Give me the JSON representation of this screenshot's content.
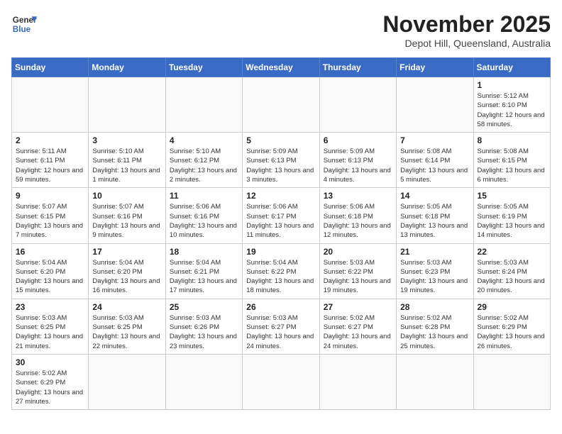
{
  "header": {
    "logo_general": "General",
    "logo_blue": "Blue",
    "month_title": "November 2025",
    "subtitle": "Depot Hill, Queensland, Australia"
  },
  "weekdays": [
    "Sunday",
    "Monday",
    "Tuesday",
    "Wednesday",
    "Thursday",
    "Friday",
    "Saturday"
  ],
  "weeks": [
    [
      {
        "day": "",
        "info": ""
      },
      {
        "day": "",
        "info": ""
      },
      {
        "day": "",
        "info": ""
      },
      {
        "day": "",
        "info": ""
      },
      {
        "day": "",
        "info": ""
      },
      {
        "day": "",
        "info": ""
      },
      {
        "day": "1",
        "info": "Sunrise: 5:12 AM\nSunset: 6:10 PM\nDaylight: 12 hours and 58 minutes."
      }
    ],
    [
      {
        "day": "2",
        "info": "Sunrise: 5:11 AM\nSunset: 6:11 PM\nDaylight: 12 hours and 59 minutes."
      },
      {
        "day": "3",
        "info": "Sunrise: 5:10 AM\nSunset: 6:11 PM\nDaylight: 13 hours and 1 minute."
      },
      {
        "day": "4",
        "info": "Sunrise: 5:10 AM\nSunset: 6:12 PM\nDaylight: 13 hours and 2 minutes."
      },
      {
        "day": "5",
        "info": "Sunrise: 5:09 AM\nSunset: 6:13 PM\nDaylight: 13 hours and 3 minutes."
      },
      {
        "day": "6",
        "info": "Sunrise: 5:09 AM\nSunset: 6:13 PM\nDaylight: 13 hours and 4 minutes."
      },
      {
        "day": "7",
        "info": "Sunrise: 5:08 AM\nSunset: 6:14 PM\nDaylight: 13 hours and 5 minutes."
      },
      {
        "day": "8",
        "info": "Sunrise: 5:08 AM\nSunset: 6:15 PM\nDaylight: 13 hours and 6 minutes."
      }
    ],
    [
      {
        "day": "9",
        "info": "Sunrise: 5:07 AM\nSunset: 6:15 PM\nDaylight: 13 hours and 7 minutes."
      },
      {
        "day": "10",
        "info": "Sunrise: 5:07 AM\nSunset: 6:16 PM\nDaylight: 13 hours and 9 minutes."
      },
      {
        "day": "11",
        "info": "Sunrise: 5:06 AM\nSunset: 6:16 PM\nDaylight: 13 hours and 10 minutes."
      },
      {
        "day": "12",
        "info": "Sunrise: 5:06 AM\nSunset: 6:17 PM\nDaylight: 13 hours and 11 minutes."
      },
      {
        "day": "13",
        "info": "Sunrise: 5:06 AM\nSunset: 6:18 PM\nDaylight: 13 hours and 12 minutes."
      },
      {
        "day": "14",
        "info": "Sunrise: 5:05 AM\nSunset: 6:18 PM\nDaylight: 13 hours and 13 minutes."
      },
      {
        "day": "15",
        "info": "Sunrise: 5:05 AM\nSunset: 6:19 PM\nDaylight: 13 hours and 14 minutes."
      }
    ],
    [
      {
        "day": "16",
        "info": "Sunrise: 5:04 AM\nSunset: 6:20 PM\nDaylight: 13 hours and 15 minutes."
      },
      {
        "day": "17",
        "info": "Sunrise: 5:04 AM\nSunset: 6:20 PM\nDaylight: 13 hours and 16 minutes."
      },
      {
        "day": "18",
        "info": "Sunrise: 5:04 AM\nSunset: 6:21 PM\nDaylight: 13 hours and 17 minutes."
      },
      {
        "day": "19",
        "info": "Sunrise: 5:04 AM\nSunset: 6:22 PM\nDaylight: 13 hours and 18 minutes."
      },
      {
        "day": "20",
        "info": "Sunrise: 5:03 AM\nSunset: 6:22 PM\nDaylight: 13 hours and 19 minutes."
      },
      {
        "day": "21",
        "info": "Sunrise: 5:03 AM\nSunset: 6:23 PM\nDaylight: 13 hours and 19 minutes."
      },
      {
        "day": "22",
        "info": "Sunrise: 5:03 AM\nSunset: 6:24 PM\nDaylight: 13 hours and 20 minutes."
      }
    ],
    [
      {
        "day": "23",
        "info": "Sunrise: 5:03 AM\nSunset: 6:25 PM\nDaylight: 13 hours and 21 minutes."
      },
      {
        "day": "24",
        "info": "Sunrise: 5:03 AM\nSunset: 6:25 PM\nDaylight: 13 hours and 22 minutes."
      },
      {
        "day": "25",
        "info": "Sunrise: 5:03 AM\nSunset: 6:26 PM\nDaylight: 13 hours and 23 minutes."
      },
      {
        "day": "26",
        "info": "Sunrise: 5:03 AM\nSunset: 6:27 PM\nDaylight: 13 hours and 24 minutes."
      },
      {
        "day": "27",
        "info": "Sunrise: 5:02 AM\nSunset: 6:27 PM\nDaylight: 13 hours and 24 minutes."
      },
      {
        "day": "28",
        "info": "Sunrise: 5:02 AM\nSunset: 6:28 PM\nDaylight: 13 hours and 25 minutes."
      },
      {
        "day": "29",
        "info": "Sunrise: 5:02 AM\nSunset: 6:29 PM\nDaylight: 13 hours and 26 minutes."
      }
    ],
    [
      {
        "day": "30",
        "info": "Sunrise: 5:02 AM\nSunset: 6:29 PM\nDaylight: 13 hours and 27 minutes."
      },
      {
        "day": "",
        "info": ""
      },
      {
        "day": "",
        "info": ""
      },
      {
        "day": "",
        "info": ""
      },
      {
        "day": "",
        "info": ""
      },
      {
        "day": "",
        "info": ""
      },
      {
        "day": "",
        "info": ""
      }
    ]
  ]
}
